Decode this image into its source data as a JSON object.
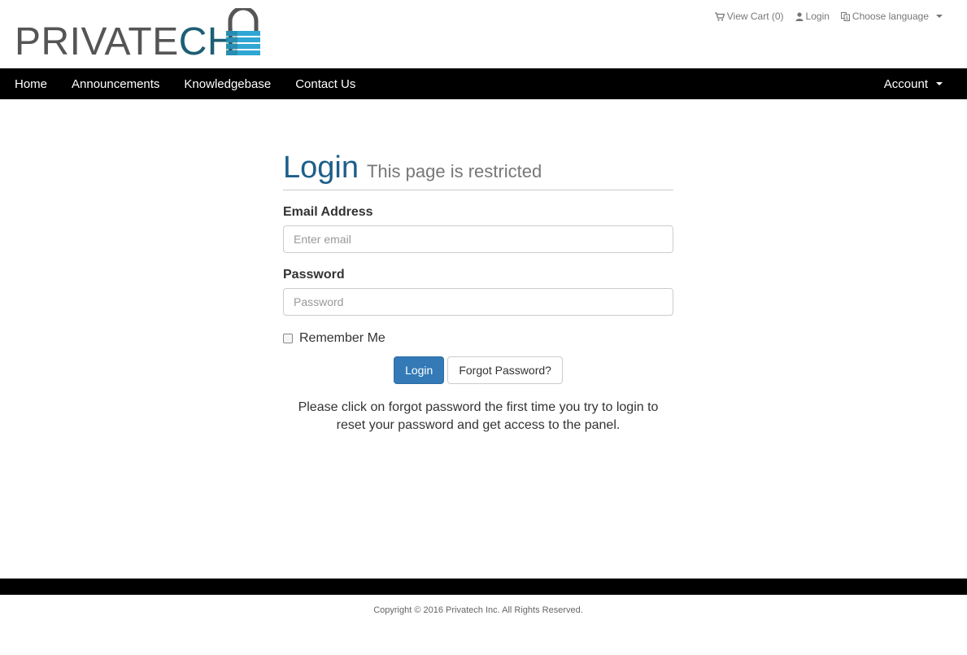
{
  "brand": {
    "name_part1": "PRIVATE",
    "name_part2": "CH",
    "colors": {
      "gray": "#555555",
      "teal": "#1d5e73",
      "lock_blue": "#2fa7d4"
    }
  },
  "top_links": {
    "cart": {
      "icon": "cart-icon",
      "label": "View Cart (0)"
    },
    "login": {
      "icon": "user-icon",
      "label": "Login"
    },
    "language": {
      "icon": "language-icon",
      "label": "Choose language"
    }
  },
  "nav": {
    "items": [
      {
        "label": "Home"
      },
      {
        "label": "Announcements"
      },
      {
        "label": "Knowledgebase"
      },
      {
        "label": "Contact Us"
      }
    ],
    "account_label": "Account"
  },
  "login_form": {
    "title": "Login",
    "subtitle": "This page is restricted",
    "email": {
      "label": "Email Address",
      "placeholder": "Enter email",
      "value": ""
    },
    "password": {
      "label": "Password",
      "placeholder": "Password",
      "value": ""
    },
    "remember_label": "Remember Me",
    "remember_checked": false,
    "login_button": "Login",
    "forgot_button": "Forgot Password?",
    "note": "Please click on forgot password the first time you try to login to reset your password and get access to the panel."
  },
  "footer": {
    "copyright": "Copyright © 2016 Privatech Inc. All Rights Reserved."
  },
  "colors": {
    "navbar_bg": "#000000",
    "primary_button": "#337ab7",
    "title_blue": "#1d5e8a"
  }
}
